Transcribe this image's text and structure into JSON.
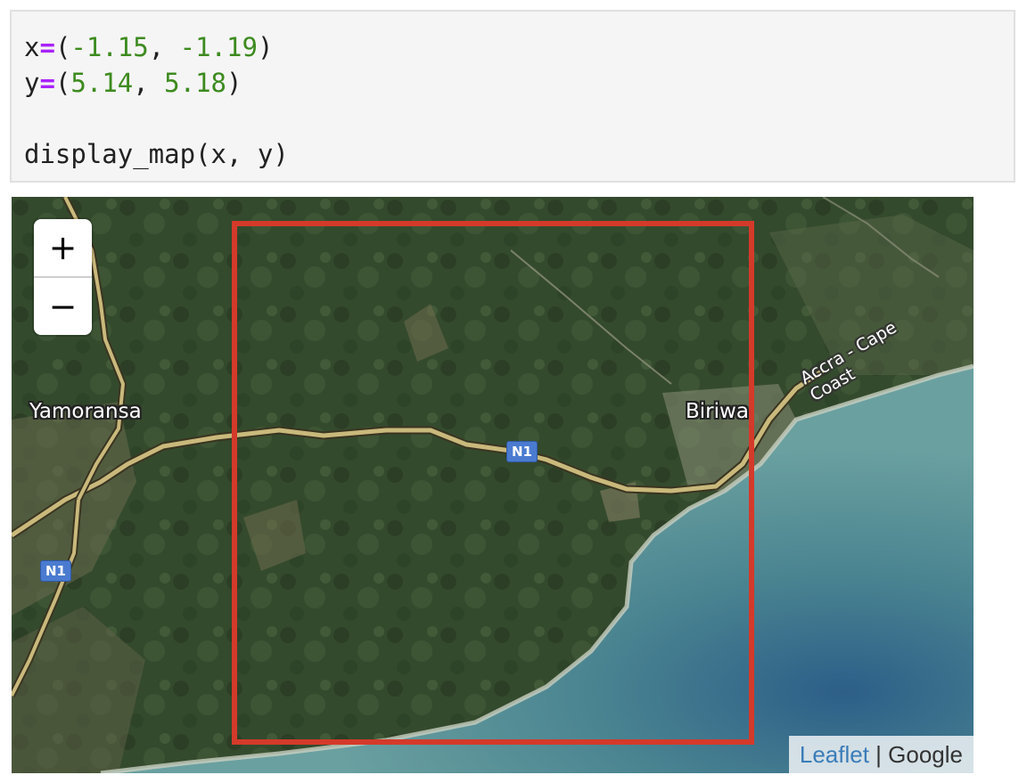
{
  "code_cell": {
    "lines": [
      [
        "x",
        "=",
        "(",
        "-1.15",
        ", ",
        "-1.19",
        ")"
      ],
      [
        "y",
        "=",
        "(",
        "5.14",
        ", ",
        "5.18",
        ")"
      ],
      [
        ""
      ],
      [
        "display_map(x, y)"
      ]
    ],
    "line1": {
      "var": "x",
      "op": "=",
      "open": "(",
      "a": "-1.15",
      "sep": ", ",
      "b": "-1.19",
      "close": ")"
    },
    "line2": {
      "var": "y",
      "op": "=",
      "open": "(",
      "a": "5.14",
      "sep": ", ",
      "b": "5.18",
      "close": ")"
    },
    "line4": "display_map(x, y)"
  },
  "map": {
    "zoom_in_label": "+",
    "zoom_out_label": "−",
    "places": {
      "yamoransa": "Yamoransa",
      "biriwa": "Biriwa"
    },
    "roads": {
      "accra_cape_coast": "Accra - Cape Coast",
      "n1_left": "N1",
      "n1_center": "N1"
    },
    "bbox_color": "#d43a2a",
    "attribution": {
      "leaflet": "Leaflet",
      "separator": " | ",
      "provider": "Google"
    }
  }
}
